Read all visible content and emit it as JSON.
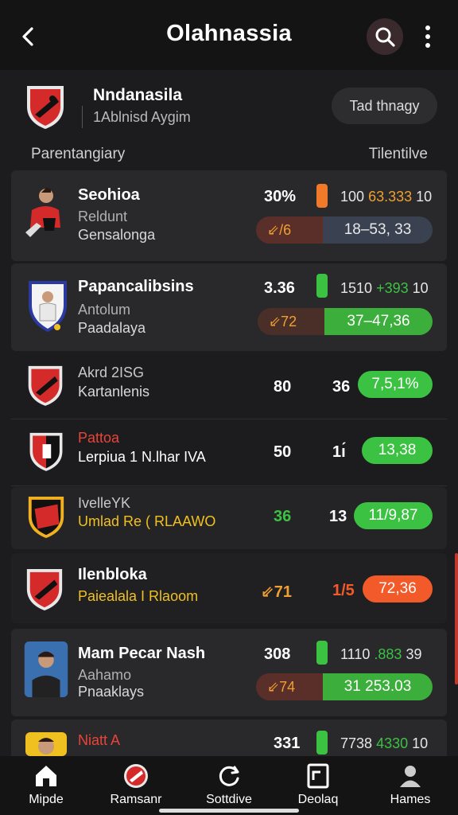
{
  "topbar": {
    "back_icon": "chevron-left-icon",
    "title": "Olahnassia",
    "search_icon": "search-icon",
    "more_icon": "more-vertical-icon"
  },
  "club": {
    "name": "Nndanasila",
    "subtitle": "1Ablnisd Aygim",
    "track_button": "Tad thnagy"
  },
  "columns": {
    "left": "Parentangiary",
    "right": "Tilentilve"
  },
  "players": [
    {
      "name": "Seohioa",
      "sub1": "Reldunt",
      "sub2": "Gensalonga",
      "stat": "30%",
      "indicator_color": "#f07a2a",
      "val_main": "100",
      "val_accent": "63.333",
      "val_end": "10",
      "comp_left": "⇙/6",
      "comp_right": "18–53, 33",
      "comp_fill": 0.0
    },
    {
      "name": "Papancalibsins",
      "sub1": "Antolum",
      "sub2": "Paadalaya",
      "stat": "3.36",
      "indicator_color": "#3cc243",
      "val_main": "1510",
      "val_accent": "+393",
      "val_end": "10",
      "comp_left": "⇙72",
      "comp_right": "37–47,36",
      "comp_fill": 1.0
    },
    {
      "name": "Akrd 2ISG",
      "sub1": "",
      "sub2": "Kartanlenis",
      "stat": "80",
      "stat2": "36",
      "score": "7,5,1%",
      "score_color": "#3cc243"
    },
    {
      "name": "Pattoa",
      "sub1": "",
      "sub2": "Lerpiua 1 N.lhar IVA",
      "stat": "50",
      "stat2": "1ı́",
      "score": "13,38",
      "score_color": "#3cc243"
    },
    {
      "name": "IvelleYK",
      "sub1": "",
      "sub2": "Umlad Re ( RLAAWO",
      "stat": "36",
      "stat2": "13",
      "score": "11/9,87",
      "score_color": "#3cc243"
    },
    {
      "name": "Ilenbloka",
      "sub1": "",
      "sub2": "Paiealala I Rlaoom",
      "stat": "⇙71",
      "stat2": "1/5",
      "score": "72,36",
      "score_color": "#f25a2a"
    },
    {
      "name": "Mam Pecar Nash",
      "sub1": "Aahamo",
      "sub2": "Pnaaklays",
      "stat": "308",
      "indicator_color": "#3cc243",
      "val_main": "1110",
      "val_accent": ".883",
      "val_end": "39",
      "comp_left": "⇙74",
      "comp_right": "31 253.03",
      "comp_fill": 1.0
    },
    {
      "name": "Niatt A",
      "stat": "331",
      "indicator_color": "#3cc243",
      "val_main": "7738",
      "val_accent": "4330",
      "val_end": "10"
    }
  ],
  "nav": [
    {
      "label": "Mipde",
      "icon": "home-icon"
    },
    {
      "label": "Ramsanr",
      "icon": "club-shield-icon"
    },
    {
      "label": "Sottdive",
      "icon": "refresh-icon"
    },
    {
      "label": "Deolaq",
      "icon": "document-icon"
    },
    {
      "label": "Hames",
      "icon": "user-icon"
    }
  ]
}
